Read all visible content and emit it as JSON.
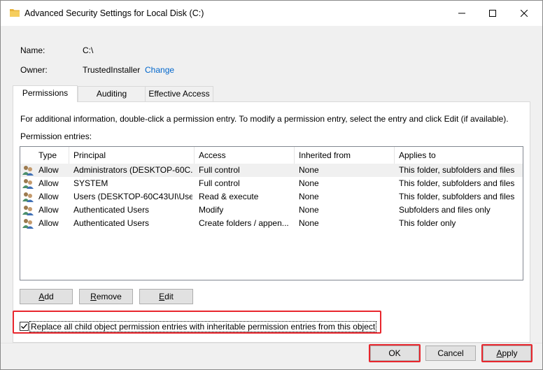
{
  "window": {
    "title": "Advanced Security Settings for Local Disk (C:)",
    "colors": {
      "accent_link": "#0066cc",
      "highlight_box": "#e8262d"
    }
  },
  "info": {
    "name_label": "Name:",
    "name_value": "C:\\",
    "owner_label": "Owner:",
    "owner_value": "TrustedInstaller",
    "change_link": "Change"
  },
  "tabs": [
    {
      "label": "Permissions",
      "active": true
    },
    {
      "label": "Auditing",
      "active": false
    },
    {
      "label": "Effective Access",
      "active": false
    }
  ],
  "permissions": {
    "instructions": "For additional information, double-click a permission entry. To modify a permission entry, select the entry and click Edit (if available).",
    "entries_label": "Permission entries:",
    "columns": [
      "Type",
      "Principal",
      "Access",
      "Inherited from",
      "Applies to"
    ],
    "rows": [
      {
        "type": "Allow",
        "principal": "Administrators (DESKTOP-60C...",
        "access": "Full control",
        "inherited": "None",
        "applies": "This folder, subfolders and files"
      },
      {
        "type": "Allow",
        "principal": "SYSTEM",
        "access": "Full control",
        "inherited": "None",
        "applies": "This folder, subfolders and files"
      },
      {
        "type": "Allow",
        "principal": "Users (DESKTOP-60C43UI\\Use...",
        "access": "Read & execute",
        "inherited": "None",
        "applies": "This folder, subfolders and files"
      },
      {
        "type": "Allow",
        "principal": "Authenticated Users",
        "access": "Modify",
        "inherited": "None",
        "applies": "Subfolders and files only"
      },
      {
        "type": "Allow",
        "principal": "Authenticated Users",
        "access": "Create folders / appen...",
        "inherited": "None",
        "applies": "This folder only"
      }
    ],
    "add_label": {
      "pre": "",
      "key": "A",
      "post": "dd"
    },
    "remove_label": {
      "pre": "",
      "key": "R",
      "post": "emove"
    },
    "edit_label": {
      "pre": "",
      "key": "E",
      "post": "dit"
    },
    "replace_checkbox_label": "Replace all child object permission entries with inheritable permission entries from this object",
    "replace_checked": true
  },
  "footer": {
    "ok_label": "OK",
    "cancel_label": "Cancel",
    "apply_label": {
      "pre": "",
      "key": "A",
      "post": "pply"
    }
  },
  "icons": {
    "title": "folder-icon",
    "row": "users-icon",
    "minimize": "minimize-icon",
    "maximize": "maximize-icon",
    "close": "close-icon",
    "check": "checkmark-icon"
  }
}
